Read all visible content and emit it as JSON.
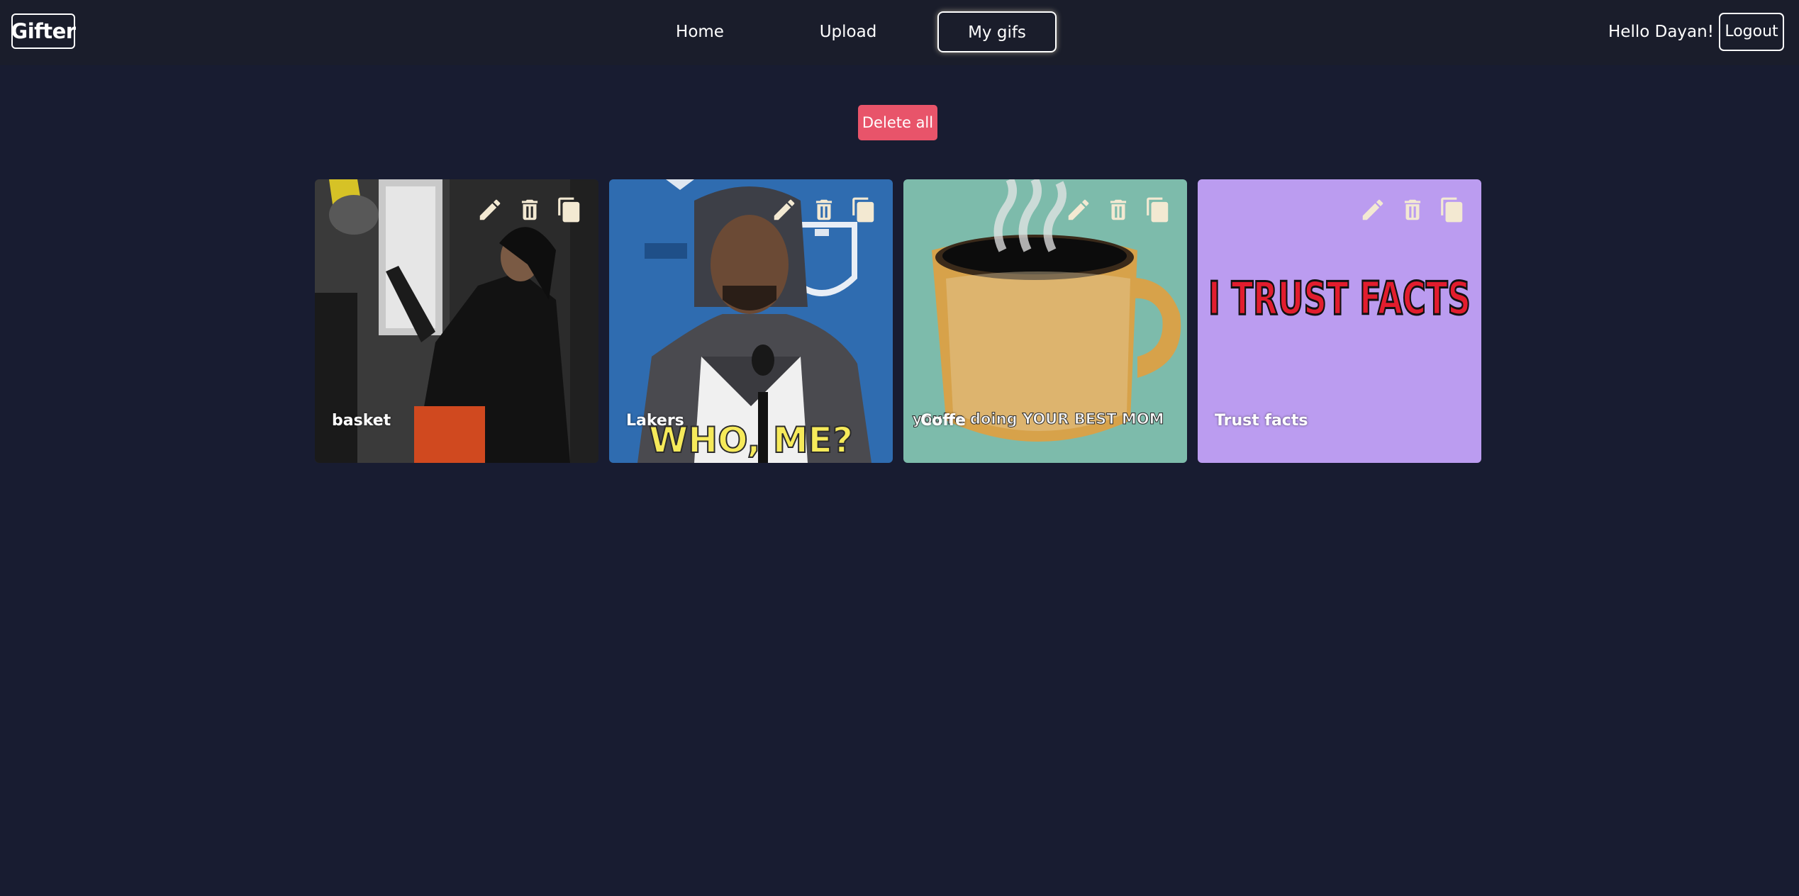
{
  "app": {
    "logo": "Gifter"
  },
  "nav": {
    "links": [
      {
        "label": "Home"
      },
      {
        "label": "Upload"
      },
      {
        "label": "My gifs",
        "active": true
      }
    ],
    "greeting": "Hello Dayan!",
    "logout": "Logout"
  },
  "actions": {
    "delete_all": "Delete all"
  },
  "colors": {
    "background": "#181c31",
    "navbar": "#1a1d2b",
    "delete_button": "#e8546a",
    "icon_color": "#f3e9d2"
  },
  "gifs": [
    {
      "title": "basket",
      "caption_overlay": "",
      "icons": [
        "pencil-icon",
        "trash-icon",
        "copy-icon"
      ]
    },
    {
      "title": "Lakers",
      "caption_overlay": "WHO, ME?",
      "icons": [
        "pencil-icon",
        "trash-icon",
        "copy-icon"
      ]
    },
    {
      "title": "Coffe",
      "caption_overlay": "you're doing YOUR BEST MOM",
      "icons": [
        "pencil-icon",
        "trash-icon",
        "copy-icon"
      ]
    },
    {
      "title": "Trust facts",
      "caption_overlay": "I TRUST FACTS",
      "icons": [
        "pencil-icon",
        "trash-icon",
        "copy-icon"
      ]
    }
  ]
}
